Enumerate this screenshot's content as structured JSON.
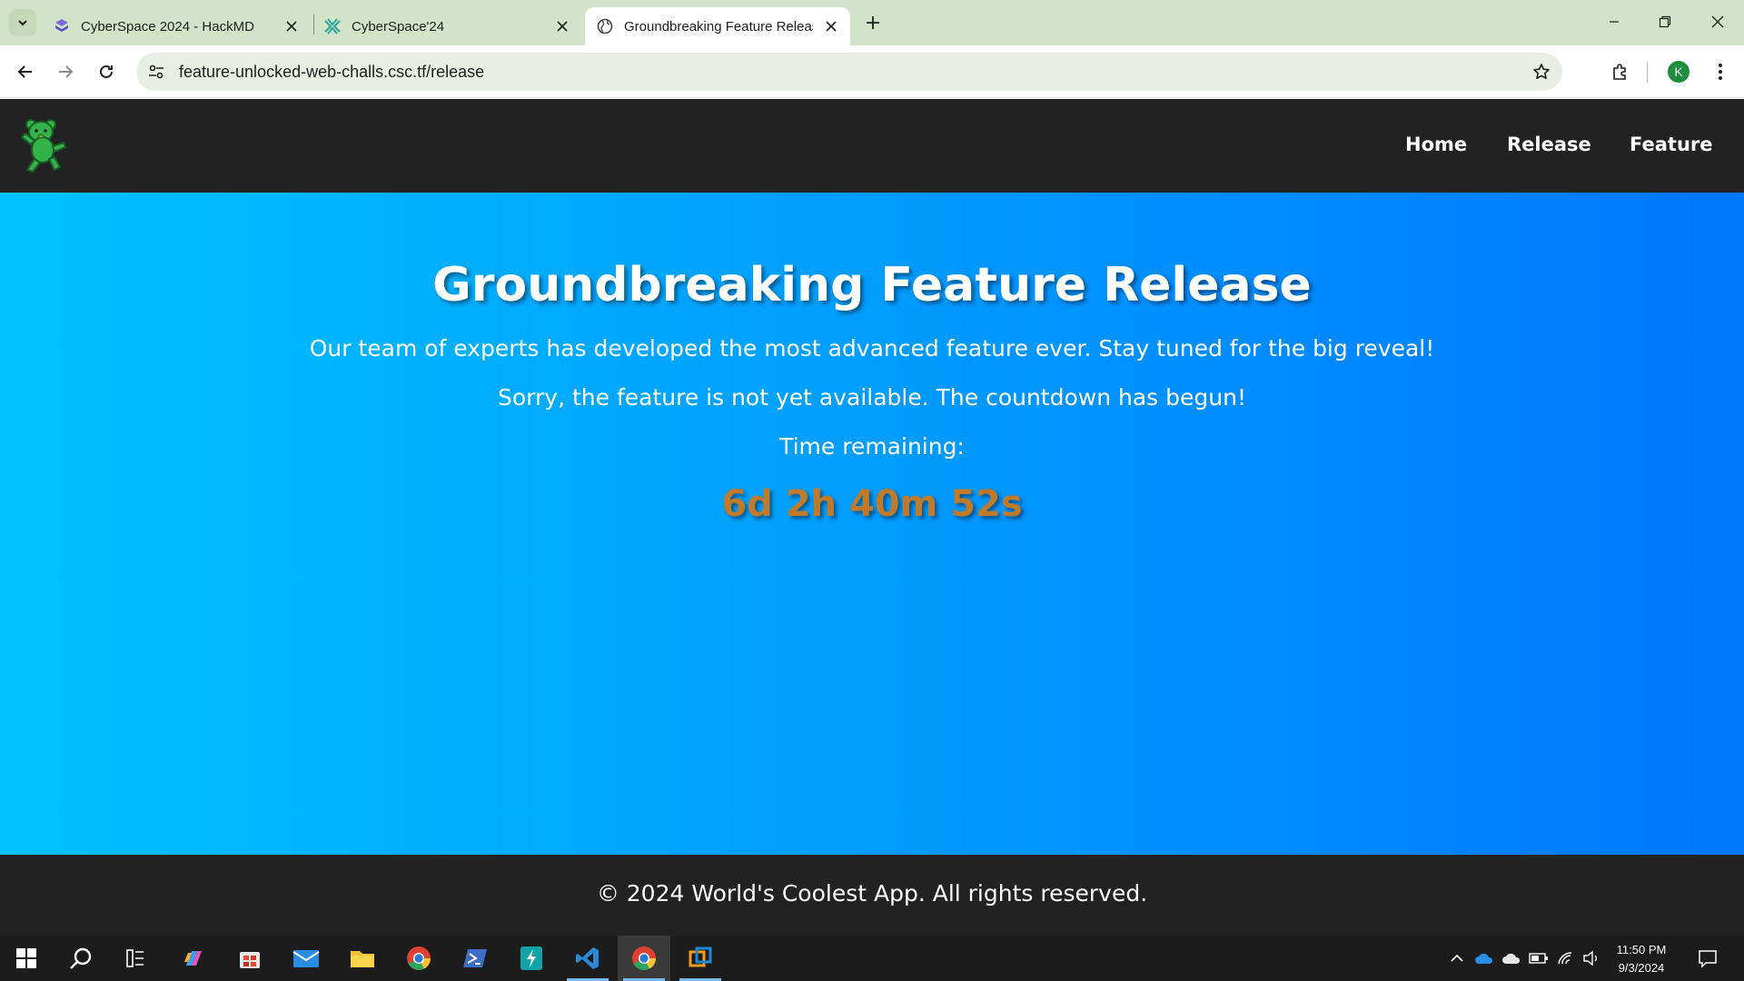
{
  "browser": {
    "tabs": [
      {
        "title": "CyberSpace 2024 - HackMD",
        "icon": "hackmd-icon",
        "active": false
      },
      {
        "title": "CyberSpace'24",
        "icon": "ctfd-icon",
        "active": false
      },
      {
        "title": "Groundbreaking Feature Releas",
        "icon": "globe-icon",
        "active": true
      }
    ],
    "url": "feature-unlocked-web-challs.csc.tf/release",
    "profile_initial": "K"
  },
  "site": {
    "nav": [
      "Home",
      "Release",
      "Feature"
    ],
    "hero": {
      "title": "Groundbreaking Feature Release",
      "lead": "Our team of experts has developed the most advanced feature ever. Stay tuned for the big reveal!",
      "notice": "Sorry, the feature is not yet available. The countdown has begun!",
      "time_label": "Time remaining:",
      "countdown": "6d 2h 40m 52s"
    },
    "footer": "© 2024 World's Coolest App. All rights reserved."
  },
  "taskbar": {
    "time": "11:50 PM",
    "date": "9/3/2024"
  },
  "colors": {
    "hero_gradient_start": "#00c2ff",
    "hero_gradient_end": "#0077ff",
    "header_bg": "#222222",
    "countdown": "#c07a2b",
    "tabstrip": "#d3e3c7"
  }
}
